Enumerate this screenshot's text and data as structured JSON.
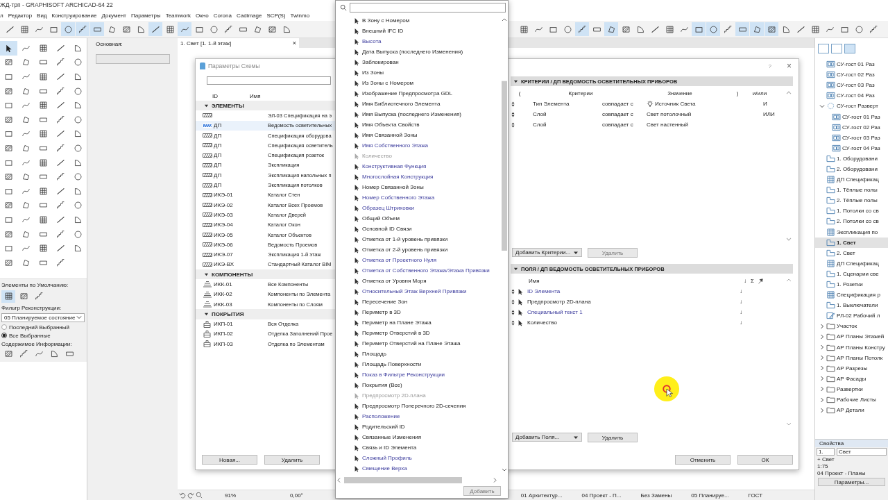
{
  "window": {
    "title": "ЖД-трп - GRAPHISOFT ARCHICAD-64 22"
  },
  "menu": [
    "л",
    "Редактор",
    "Вид",
    "Конструирование",
    "Документ",
    "Параметры",
    "Teamwork",
    "Окно",
    "Corona",
    "Cadimage",
    "SCP(S)",
    "Twinmo"
  ],
  "toolbar": {
    "left": [
      {
        "selected": false
      },
      {
        "selected": false
      },
      {
        "selected": false
      },
      {
        "selected": false
      },
      {
        "selected": true
      },
      {
        "selected": true
      },
      {
        "selected": true
      },
      {
        "selected": false
      },
      {
        "selected": false
      },
      {
        "selected": false
      },
      {
        "selected": true
      },
      {
        "selected": false
      },
      {
        "selected": true
      },
      {
        "selected": false
      },
      {
        "selected": false
      },
      {
        "selected": false
      },
      {
        "selected": false
      },
      {
        "selected": false
      },
      {
        "selected": false
      },
      {
        "selected": false
      }
    ],
    "right": [
      {
        "selected": false
      },
      {
        "selected": false
      },
      {
        "selected": false
      },
      {
        "selected": false
      },
      {
        "selected": true
      },
      {
        "selected": false
      },
      {
        "selected": true
      },
      {
        "selected": false
      },
      {
        "selected": false
      },
      {
        "selected": false
      },
      {
        "selected": false
      },
      {
        "selected": false
      },
      {
        "selected": true
      },
      {
        "selected": true
      },
      {
        "selected": false
      },
      {
        "selected": true
      },
      {
        "selected": true
      },
      {
        "selected": true
      },
      {
        "selected": false
      },
      {
        "selected": false
      },
      {
        "selected": false
      },
      {
        "selected": false
      },
      {
        "selected": false
      },
      {
        "selected": false
      },
      {
        "selected": false
      }
    ]
  },
  "toolbox": {
    "tools": [
      {
        "selected": true
      },
      {
        "selected": false
      },
      {
        "selected": false
      },
      {
        "selected": false
      },
      {
        "selected": false
      },
      {
        "selected": false
      },
      {
        "selected": false
      },
      {
        "selected": false
      },
      {
        "selected": false
      },
      {
        "selected": false
      },
      {
        "selected": false
      },
      {
        "selected": false
      },
      {
        "selected": false
      },
      {
        "selected": false
      },
      {
        "selected": false
      },
      {
        "selected": false
      },
      {
        "selected": false
      },
      {
        "selected": false
      },
      {
        "selected": false
      },
      {
        "selected": false
      },
      {
        "selected": false
      },
      {
        "selected": false
      },
      {
        "selected": false
      },
      {
        "selected": false
      },
      {
        "selected": false
      },
      {
        "selected": false
      },
      {
        "selected": false
      },
      {
        "selected": false
      },
      {
        "selected": false
      },
      {
        "selected": false
      },
      {
        "selected": false
      },
      {
        "selected": false
      },
      {
        "selected": false
      },
      {
        "selected": false
      },
      {
        "selected": false
      },
      {
        "selected": false
      },
      {
        "selected": false
      },
      {
        "selected": false
      },
      {
        "selected": false
      },
      {
        "selected": false
      },
      {
        "selected": false
      },
      {
        "selected": false
      },
      {
        "selected": false
      },
      {
        "selected": false
      },
      {
        "selected": false
      },
      {
        "selected": false
      },
      {
        "selected": false
      },
      {
        "selected": false
      },
      {
        "selected": false
      },
      {
        "selected": false
      },
      {
        "selected": false
      },
      {
        "selected": false
      },
      {
        "selected": false
      },
      {
        "selected": false
      },
      {
        "selected": false
      },
      {
        "selected": false
      },
      {
        "selected": false
      },
      {
        "selected": false
      },
      {
        "selected": false
      },
      {
        "selected": false
      },
      {
        "selected": false
      },
      {
        "selected": false
      },
      {
        "selected": false
      },
      {
        "selected": false
      },
      {
        "selected": false
      },
      {
        "selected": false
      },
      {
        "selected": false
      },
      {
        "selected": false
      },
      {
        "selected": false
      },
      {
        "selected": false
      },
      {
        "selected": false
      },
      {
        "selected": false
      },
      {
        "selected": false
      },
      {
        "selected": false
      },
      {
        "selected": false
      },
      {
        "selected": false
      },
      {
        "selected": false
      },
      {
        "selected": false
      },
      {
        "selected": false
      }
    ],
    "defaults_label": "Элементы по Умолчанию:",
    "defaults": [
      {
        "selected": true
      },
      {
        "selected": false
      },
      {
        "selected": false
      }
    ],
    "filter_label": "Фильтр Реконструкции:",
    "filter_value": "05 Планируемое состояние",
    "selection": [
      {
        "label": "Последний Выбранный",
        "selected": false
      },
      {
        "label": "Все Выбранные",
        "selected": true
      }
    ],
    "info_label": "Содержимое Информации:"
  },
  "info_box": {
    "label": "Основная:"
  },
  "tab": {
    "label": "1. Свет [1. 1-й этаж]",
    "close": "×"
  },
  "dialog": {
    "title": "Параметры Схемы",
    "help": "?",
    "close": "×",
    "scheme_list": {
      "columns": [
        "ID",
        "Имя"
      ],
      "groups": [
        {
          "label": "ЭЛЕМЕНТЫ",
          "kind": "elements",
          "expanded": true,
          "rows": [
            {
              "name": "ЭЛ-03 Спецификация  на э",
              "selected": false
            },
            {
              "id": "ДП",
              "name": "Ведомость осветительных",
              "selected": true
            },
            {
              "id": "ДП",
              "name": "Спецификация оборудова",
              "selected": false
            },
            {
              "id": "ДП",
              "name": "Спецификация осветитель",
              "selected": false
            },
            {
              "id": "ДП",
              "name": "Спецификация розеток",
              "selected": false
            },
            {
              "id": "ДП",
              "name": "Экспликация",
              "selected": false
            },
            {
              "id": "ДП",
              "name": "Экспликация напольных п",
              "selected": false
            },
            {
              "id": "ДП",
              "name": "Экспликация потолков",
              "selected": false
            },
            {
              "id": "ИКЭ-01",
              "name": "Каталог Стен",
              "selected": false
            },
            {
              "id": "ИКЭ-02",
              "name": "Каталог Всех Проемов",
              "selected": false
            },
            {
              "id": "ИКЭ-03",
              "name": "Каталог Дверей",
              "selected": false
            },
            {
              "id": "ИКЭ-04",
              "name": "Каталог Окон",
              "selected": false
            },
            {
              "id": "ИКЭ-05",
              "name": "Каталог Объектов",
              "selected": false
            },
            {
              "id": "ИКЭ-06",
              "name": "Ведомость Проемов",
              "selected": false
            },
            {
              "id": "ИКЭ-07",
              "name": "Экспликация 1-й этаж",
              "selected": false
            },
            {
              "id": "ИКЭ-ВХ",
              "name": "Стандартный Каталог BIM",
              "selected": false
            }
          ]
        },
        {
          "label": "КОМПОНЕНТЫ",
          "kind": "components",
          "expanded": true,
          "rows": [
            {
              "id": "ИКК-01",
              "name": "Все Компоненты",
              "selected": false
            },
            {
              "id": "ИКК-02",
              "name": "Компоненты по Элемента",
              "selected": false
            },
            {
              "id": "ИКК-03",
              "name": "Компоненты по Слоям",
              "selected": false
            }
          ]
        },
        {
          "label": "ПОКРЫТИЯ",
          "kind": "surfaces",
          "expanded": true,
          "rows": [
            {
              "id": "ИКП-01",
              "name": "Вся Отделка",
              "selected": false
            },
            {
              "id": "ИКП-02",
              "name": "Отделка Заполнений Прое",
              "selected": false
            },
            {
              "id": "ИКП-03",
              "name": "Отделка по Элементам",
              "selected": false
            }
          ]
        }
      ],
      "buttons": [
        "Новая...",
        "Удалить"
      ]
    },
    "criteria": {
      "title": "КРИТЕРИИ / ДП ВЕДОМОСТЬ ОСВЕТИТЕЛЬНЫХ ПРИБОРОВ",
      "expanded": true,
      "columns": [
        "(",
        "Критерии",
        "Значение",
        ")",
        "и/или"
      ],
      "rows": [
        {
          "criterion": "Тип Элемента",
          "operator": "совпадает с",
          "value": "Источник Света",
          "kind": "element_type",
          "logic": "И"
        },
        {
          "criterion": "Слой",
          "operator": "совпадает с",
          "value": "Свет потолочный",
          "kind": "text",
          "logic": "ИЛИ"
        },
        {
          "criterion": "Слой",
          "operator": "совпадает с",
          "value": "Свет настенный",
          "kind": "text"
        }
      ],
      "add_button": "Добавить Критерии...",
      "delete_button": {
        "label": "Удалить",
        "disabled": true
      }
    },
    "fields": {
      "title": "ПОЛЯ / ДП ВЕДОМОСТЬ ОСВЕТИТЕЛЬНЫХ ПРИБОРОВ",
      "expanded": true,
      "columns": [
        "Имя",
        "↓",
        "Σ"
      ],
      "rows": [
        {
          "name": "ID Элемента",
          "kind": "custom",
          "sort": "↓"
        },
        {
          "name": "Предпросмотр 2D-плана",
          "kind": "standard",
          "sort": "↓"
        },
        {
          "name": "Специальный текст  1",
          "kind": "custom",
          "sort": "↓"
        },
        {
          "name": "Количество",
          "kind": "standard",
          "sort": "↓"
        }
      ],
      "add_button": "Добавить Поля...",
      "delete_button": {
        "label": "Удалить",
        "disabled": false
      }
    },
    "footer_buttons": [
      "Отменить",
      "ОК"
    ]
  },
  "dropdown": {
    "items": [
      {
        "label": "В Зону с Номером",
        "kind": "standard",
        "disabled": false
      },
      {
        "label": "Внешний IFC ID",
        "kind": "standard",
        "disabled": false
      },
      {
        "label": "Высота",
        "kind": "custom",
        "disabled": false
      },
      {
        "label": "Дата Выпуска (последнего Изменения)",
        "kind": "standard",
        "disabled": false
      },
      {
        "label": "Заблокирован",
        "kind": "standard",
        "disabled": false
      },
      {
        "label": "Из Зоны",
        "kind": "standard",
        "disabled": false
      },
      {
        "label": "Из Зоны с Номером",
        "kind": "standard",
        "disabled": false
      },
      {
        "label": "Изображение Предпросмотра GDL",
        "kind": "standard",
        "disabled": false
      },
      {
        "label": "Имя Библиотечного Элемента",
        "kind": "standard",
        "disabled": false
      },
      {
        "label": "Имя Выпуска (последнего Изменения)",
        "kind": "standard",
        "disabled": false
      },
      {
        "label": "Имя Объекта Свойств",
        "kind": "standard",
        "disabled": false
      },
      {
        "label": "Имя Связанной Зоны",
        "kind": "standard",
        "disabled": false
      },
      {
        "label": "Имя Собственного Этажа",
        "kind": "custom",
        "disabled": false
      },
      {
        "label": "Количество",
        "kind": "standard",
        "disabled": true
      },
      {
        "label": "Конструктивная Функция",
        "kind": "custom",
        "disabled": false
      },
      {
        "label": "Многослойная Конструкция",
        "kind": "custom",
        "disabled": false
      },
      {
        "label": "Номер Связанной Зоны",
        "kind": "standard",
        "disabled": false
      },
      {
        "label": "Номер Собственного Этажа",
        "kind": "custom",
        "disabled": false
      },
      {
        "label": "Образец Штриховки",
        "kind": "custom",
        "disabled": false
      },
      {
        "label": "Общий Объем",
        "kind": "standard",
        "disabled": false
      },
      {
        "label": "Основной ID Связи",
        "kind": "standard",
        "disabled": false
      },
      {
        "label": "Отметка от 1-й уровень привязки",
        "kind": "standard",
        "disabled": false
      },
      {
        "label": "Отметка от 2-й уровень привязки",
        "kind": "standard",
        "disabled": false
      },
      {
        "label": "Отметка от Проектного Нуля",
        "kind": "custom",
        "disabled": false
      },
      {
        "label": "Отметка от Собственного Этажа/Этажа Привязки",
        "kind": "custom",
        "disabled": false
      },
      {
        "label": "Отметка от Уровня Моря",
        "kind": "standard",
        "disabled": false
      },
      {
        "label": "Относительный Этаж Верхней Привязки",
        "kind": "custom",
        "disabled": false
      },
      {
        "label": "Пересечение Зон",
        "kind": "standard",
        "disabled": false
      },
      {
        "label": "Периметр в 3D",
        "kind": "standard",
        "disabled": false
      },
      {
        "label": "Периметр на Плане Этажа",
        "kind": "standard",
        "disabled": false
      },
      {
        "label": "Периметр Отверстий в 3D",
        "kind": "standard",
        "disabled": false
      },
      {
        "label": "Периметр Отверстий на Плане Этажа",
        "kind": "standard",
        "disabled": false
      },
      {
        "label": "Площадь",
        "kind": "standard",
        "disabled": false
      },
      {
        "label": "Площадь Поверхности",
        "kind": "standard",
        "disabled": false
      },
      {
        "label": "Показ в Фильтре Реконструкции",
        "kind": "custom",
        "disabled": false
      },
      {
        "label": "Покрытия (Все)",
        "kind": "standard",
        "disabled": false
      },
      {
        "label": "Предпросмотр 2D-плана",
        "kind": "standard",
        "disabled": true
      },
      {
        "label": "Предпросмотр Поперечного 2D-сечения",
        "kind": "standard",
        "disabled": false
      },
      {
        "label": "Расположение",
        "kind": "custom",
        "disabled": false
      },
      {
        "label": "Родительский ID",
        "kind": "standard",
        "disabled": false
      },
      {
        "label": "Связанные Изменения",
        "kind": "standard",
        "disabled": false
      },
      {
        "label": "Связь и ID Элемента",
        "kind": "standard",
        "disabled": false
      },
      {
        "label": "Сложный Профиль",
        "kind": "custom",
        "disabled": false
      },
      {
        "label": "Смещение Верха",
        "kind": "custom",
        "disabled": false
      }
    ],
    "add_button": {
      "label": "Добавить",
      "disabled": true
    }
  },
  "navigator": {
    "tree": [
      {
        "label": "СУ-гост 01 Раз",
        "kind": "view",
        "selected": false
      },
      {
        "label": "СУ-гост 02 Раз",
        "kind": "view",
        "selected": false
      },
      {
        "label": "СУ-гост 03 Раз",
        "kind": "view",
        "selected": false
      },
      {
        "label": "СУ-гост 04 Раз",
        "kind": "view",
        "selected": false
      },
      {
        "label": "СУ-гост   Разверт",
        "kind": "group",
        "selected": false,
        "expanded": true,
        "children": [
          {
            "label": "СУ-гост 01 Раз",
            "kind": "view",
            "selected": false
          },
          {
            "label": "СУ-гост 02 Раз",
            "kind": "view",
            "selected": false
          },
          {
            "label": "СУ-гост 03 Раз",
            "kind": "view",
            "selected": false
          },
          {
            "label": "СУ-гост 04 Раз",
            "kind": "view",
            "selected": false
          }
        ]
      },
      {
        "label": "1. Оборудовани",
        "kind": "plan",
        "selected": false
      },
      {
        "label": "2. Оборудовани",
        "kind": "plan",
        "selected": false
      },
      {
        "label": "ДП Спецификац",
        "kind": "schedule",
        "selected": false
      },
      {
        "label": "1. Тёплые полы",
        "kind": "plan",
        "selected": false
      },
      {
        "label": "2. Тёплые полы",
        "kind": "plan",
        "selected": false
      },
      {
        "label": "1. Потолки со св",
        "kind": "plan",
        "selected": false
      },
      {
        "label": "2. Потолки со св",
        "kind": "plan",
        "selected": false
      },
      {
        "label": "Экспликация по",
        "kind": "schedule",
        "selected": false
      },
      {
        "label": "1. Свет",
        "kind": "plan",
        "selected": true
      },
      {
        "label": "2. Свет",
        "kind": "plan",
        "selected": false
      },
      {
        "label": "ДП Спецификац",
        "kind": "schedule",
        "selected": false
      },
      {
        "label": "1. Сценарии све",
        "kind": "plan",
        "selected": false
      },
      {
        "label": "1. Розетки",
        "kind": "plan",
        "selected": false
      },
      {
        "label": "Спецификация р",
        "kind": "schedule",
        "selected": false
      },
      {
        "label": "1. Выключатели",
        "kind": "plan",
        "selected": false
      },
      {
        "label": "РЛ-02 Рабочий л",
        "kind": "worksheet",
        "selected": false
      },
      {
        "label": "Участок",
        "kind": "folder",
        "selected": false,
        "expanded": false
      },
      {
        "label": "АР Планы Этажей",
        "kind": "folder",
        "selected": false,
        "expanded": false
      },
      {
        "label": "АР Планы Констру",
        "kind": "folder",
        "selected": false,
        "expanded": false
      },
      {
        "label": "АР Планы Потолк",
        "kind": "folder",
        "selected": false,
        "expanded": false
      },
      {
        "label": "АР Разрезы",
        "kind": "folder",
        "selected": false,
        "expanded": false
      },
      {
        "label": "АР Фасады",
        "kind": "folder",
        "selected": false,
        "expanded": false
      },
      {
        "label": "Развертки",
        "kind": "folder",
        "selected": false,
        "expanded": false
      },
      {
        "label": "Рабочие Листы",
        "kind": "folder",
        "selected": false,
        "expanded": false
      },
      {
        "label": "АР Детали",
        "kind": "folder",
        "selected": false,
        "expanded": false
      }
    ]
  },
  "properties": {
    "title": "Свойства",
    "id_value": "1.",
    "name_value": "Свет",
    "lines": [
      "+ Свет",
      "1:75",
      "04 Проект - Планы"
    ],
    "button": "Параметры..."
  },
  "status_bar": {
    "zoom": "91%",
    "angle": "0,00°",
    "items": [
      "01 Архитектур...",
      "04 Проект - П...",
      "Без Замены",
      "05 Планируе...",
      "ГОСТ"
    ]
  }
}
